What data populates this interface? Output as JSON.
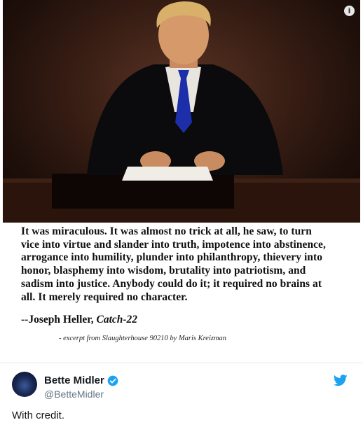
{
  "icons": {
    "info": "info-icon",
    "verified": "verified-badge-icon",
    "twitter": "twitter-bird-icon"
  },
  "colors": {
    "twitter_blue": "#1da1f2",
    "text_primary": "#14171a",
    "text_secondary": "#657786"
  },
  "photo": {
    "info_glyph": "i"
  },
  "quote": {
    "lines": [
      "It was miraculous.  It was almost no trick at all, he saw, to turn",
      "vice into virtue and slander into truth, impotence into abstinence,",
      "arrogance into humility, plunder into philanthropy, thievery into",
      "honor, blasphemy into wisdom, brutality into patriotism, and",
      "sadism into justice.  Anybody could do it; it required no brains at",
      "all.  It merely required no character."
    ],
    "attribution_prefix": "--Joseph Heller, ",
    "attribution_title": "Catch-22",
    "excerpt": "- excerpt from Slaughterhouse 90210 by Maris Kreizman"
  },
  "tweet": {
    "display_name": "Bette Midler",
    "handle": "@BetteMidler",
    "text": "With credit."
  }
}
